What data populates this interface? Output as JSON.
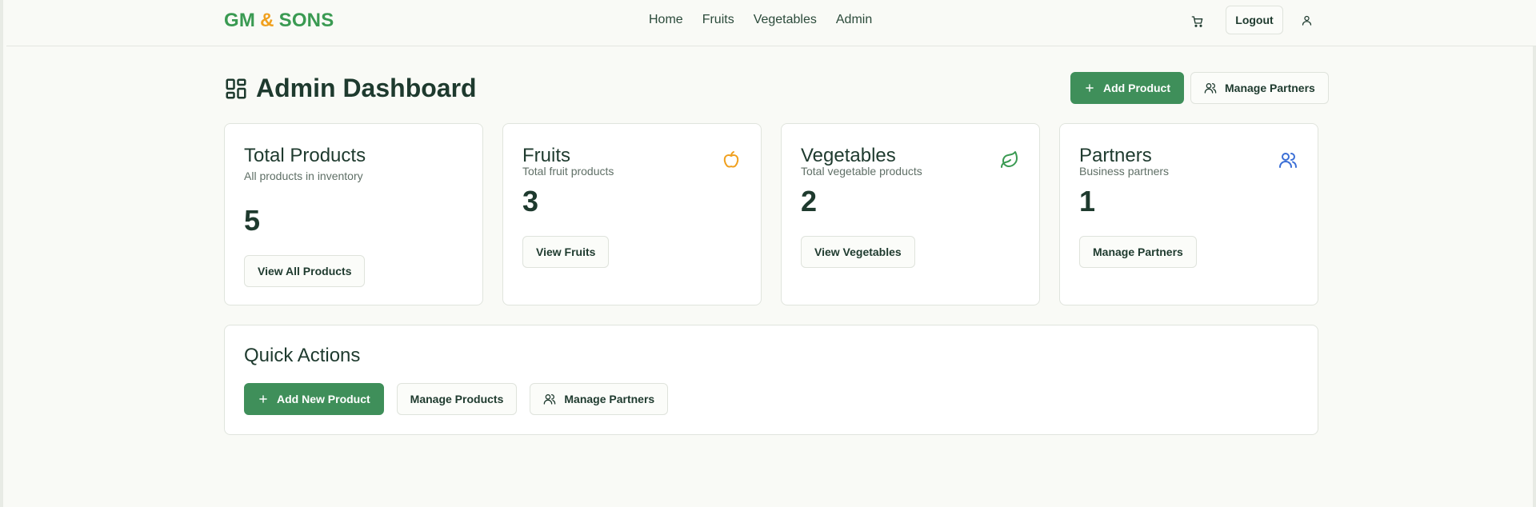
{
  "header": {
    "logo": {
      "part1": "GM",
      "amp": "&",
      "part2": "SONS"
    },
    "nav": [
      "Home",
      "Fruits",
      "Vegetables",
      "Admin"
    ],
    "logout_label": "Logout"
  },
  "page": {
    "title": "Admin Dashboard",
    "add_product_label": "Add Product",
    "manage_partners_label": "Manage Partners"
  },
  "cards": [
    {
      "title": "Total Products",
      "subtitle": "All products in inventory",
      "value": "5",
      "button": "View All Products"
    },
    {
      "title": "Fruits",
      "subtitle": "Total fruit products",
      "value": "3",
      "button": "View Fruits",
      "icon": "apple-icon"
    },
    {
      "title": "Vegetables",
      "subtitle": "Total vegetable products",
      "value": "2",
      "button": "View Vegetables",
      "icon": "leaf-icon"
    },
    {
      "title": "Partners",
      "subtitle": "Business partners",
      "value": "1",
      "button": "Manage Partners",
      "icon": "users-icon"
    }
  ],
  "quick_actions": {
    "title": "Quick Actions",
    "add_new_product_label": "Add New Product",
    "manage_products_label": "Manage Products",
    "manage_partners_label": "Manage Partners"
  },
  "colors": {
    "brand_green": "#3a9a52",
    "brand_orange": "#f0a01e",
    "primary_button": "#3f8f5a",
    "apple_icon": "#f0a01e",
    "leaf_icon": "#3a9a52",
    "users_icon": "#3b6fd6"
  }
}
